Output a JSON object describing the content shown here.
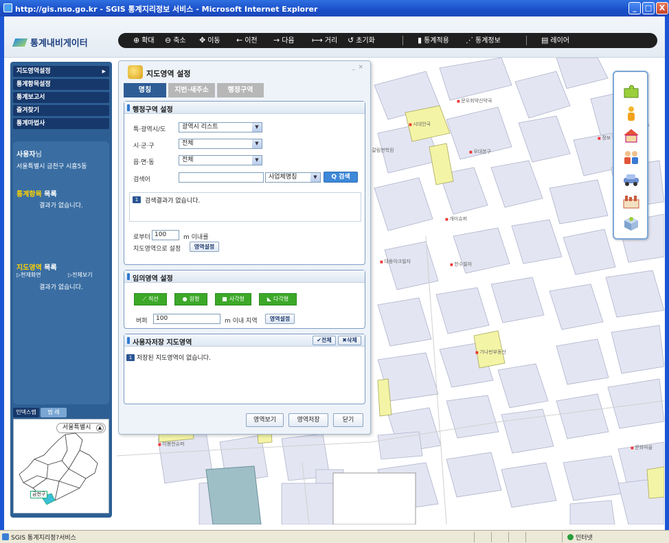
{
  "window": {
    "title": "http://gis.nso.go.kr - SGIS 통계지리정보 서비스 - Microsoft Internet Explorer",
    "minimize": "_",
    "maximize": "□",
    "close": "X"
  },
  "header": {
    "logo": "통계내비게이터",
    "toolbar": [
      {
        "label": "확대",
        "icon": "zoom-in-icon",
        "glyph": "⊕"
      },
      {
        "label": "축소",
        "icon": "zoom-out-icon",
        "glyph": "⊖"
      },
      {
        "label": "이동",
        "icon": "move-icon",
        "glyph": "✥"
      },
      {
        "label": "이전",
        "icon": "back-arrow-icon",
        "glyph": "←"
      },
      {
        "label": "다음",
        "icon": "forward-arrow-icon",
        "glyph": "→"
      },
      {
        "label": "거리",
        "icon": "distance-icon",
        "glyph": "⟼"
      },
      {
        "label": "초기화",
        "icon": "reset-icon",
        "glyph": "↺"
      },
      {
        "label": "통계적용",
        "icon": "bar-chart-icon",
        "glyph": "▮"
      },
      {
        "label": "통계정보",
        "icon": "line-chart-icon",
        "glyph": "⋰"
      },
      {
        "label": "레이어",
        "icon": "layer-icon",
        "glyph": "▤"
      }
    ]
  },
  "sidebar": {
    "menu": [
      "지도영역설정",
      "통계항목설정",
      "통계보고서",
      "즐겨찾기",
      "통계마법사"
    ],
    "user_name": "사용자",
    "user_suffix": "님",
    "user_address": "서울특별시 금천구 시흥5동",
    "stat_list_title_hl": "통계항목",
    "stat_list_title": " 목록",
    "stat_list_empty": "결과가 없습니다.",
    "area_list_title_hl": "지도영역",
    "area_list_title": " 목록",
    "link_current": "▷현재화면",
    "link_all": "▷전체보기",
    "area_list_empty": "결과가 없습니다.",
    "minitab_index": "인덱스맵",
    "minitab_legend": "범 례",
    "region": "서울특별시",
    "gu_label": "금천구"
  },
  "dialog": {
    "title": "지도영역 설정",
    "min": "_",
    "close": "×",
    "tabs": [
      "명칭",
      "지번·새주소",
      "행정구역"
    ],
    "admin_section": {
      "title": "행정구역 설정",
      "sido_label": "특·광역시/도",
      "sido_value": "광역시 리스트",
      "sigungu_label": "시·군·구",
      "sigungu_value": "전체",
      "eup_label": "읍·면·동",
      "eup_value": "전체",
      "search_label": "검색어",
      "search_value": "",
      "search_type": "사업체명칭",
      "search_button": "Q 검색",
      "result_badge": "1",
      "result_message": "검색결과가 없습니다.",
      "radius_prefix": "로부터",
      "radius_value": "100",
      "radius_suffix": "m 이내를",
      "set_area_text": "지도영역으로 설정",
      "set_area_button": "영역설정"
    },
    "custom_section": {
      "title": "임의영역 설정",
      "buttons": [
        "직선",
        "원형",
        "사각형",
        "다각형"
      ],
      "buffer_label": "버퍼",
      "buffer_value": "100",
      "buffer_suffix": "m 이내 지역",
      "set_area_button": "영역설정"
    },
    "saved_section": {
      "title": "사용자저장 지도영역",
      "select_all": "✔전체",
      "delete": "✖삭제",
      "badge": "1",
      "message": "저장된 지도영역이 없습니다."
    },
    "footer_buttons": [
      "영역보기",
      "영역저장",
      "닫기"
    ]
  },
  "map": {
    "labels": [
      "문우회약산약국",
      "시대안국",
      "갈림판학원",
      "우대본구",
      "개미슈퍼",
      "대용아크빌자",
      "한수빌자",
      "기나빈부동산",
      "이봉천슈퍼",
      "문화마을",
      "정보"
    ]
  },
  "rightbar": {
    "icons": [
      "puzzle-icon",
      "person-icon",
      "house-icon",
      "family-icon",
      "car-icon",
      "factory-icon",
      "box-icon"
    ]
  },
  "statusbar": {
    "text": "SGIS 통계지리정?서비스",
    "zone": "인터넷"
  },
  "colors": {
    "title_bar": "#1a4fc9",
    "panel_blue": "#2d5f94",
    "menu_dark": "#17386a",
    "accent_blue": "#3d88d8",
    "green_button": "#3ca828",
    "map_block": "#e3e5f2",
    "map_park": "#f4f4a6"
  }
}
